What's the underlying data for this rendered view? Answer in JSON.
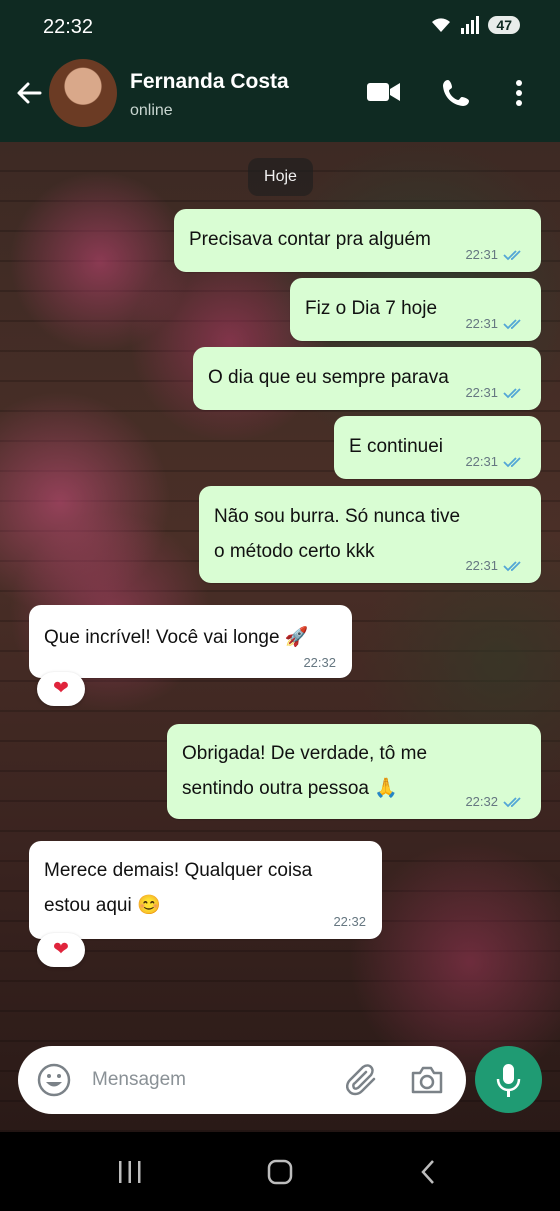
{
  "status_bar": {
    "time": "22:32",
    "battery": "47",
    "icons": [
      "wifi-icon",
      "signal-icon",
      "battery-icon"
    ]
  },
  "header": {
    "contact_name": "Fernanda Costa",
    "contact_status": "online",
    "icons": [
      "back-arrow-icon",
      "video-call-icon",
      "phone-icon",
      "more-vert-icon"
    ]
  },
  "chat": {
    "date_label": "Hoje",
    "messages": [
      {
        "direction": "out",
        "text": "Precisava contar pra alguém",
        "time": "22:31"
      },
      {
        "direction": "out",
        "text": "Fiz o Dia 7 hoje",
        "time": "22:31"
      },
      {
        "direction": "out",
        "text": "O dia que eu sempre parava",
        "time": "22:31"
      },
      {
        "direction": "out",
        "text": "E continuei",
        "time": "22:31"
      },
      {
        "direction": "out",
        "text_lines": [
          "Não sou burra. Só nunca tive",
          "o método certo kkk"
        ],
        "time": "22:31"
      },
      {
        "direction": "in",
        "text": "Que incrível! Você vai longe 🚀",
        "time": "22:32",
        "reaction": "❤"
      },
      {
        "direction": "out",
        "text_lines": [
          "Obrigada! De verdade, tô me",
          "sentindo outra pessoa 🙏"
        ],
        "time": "22:32"
      },
      {
        "direction": "in",
        "text_lines": [
          "Merece demais! Qualquer coisa",
          "estou aqui 😊"
        ],
        "time": "22:32",
        "reaction": "❤"
      }
    ]
  },
  "composer": {
    "placeholder": "Mensagem",
    "icons": [
      "emoji-icon",
      "attach-icon",
      "camera-icon",
      "mic-icon"
    ]
  },
  "nav": {
    "icons": [
      "recents-icon",
      "home-icon",
      "back-icon"
    ]
  },
  "colors": {
    "header_bg": "#0f2a22",
    "outgoing_bubble": "#d9fdd3",
    "incoming_bubble": "#ffffff",
    "read_ticks": "#53a6d6",
    "mic_button": "#1f9b73"
  }
}
